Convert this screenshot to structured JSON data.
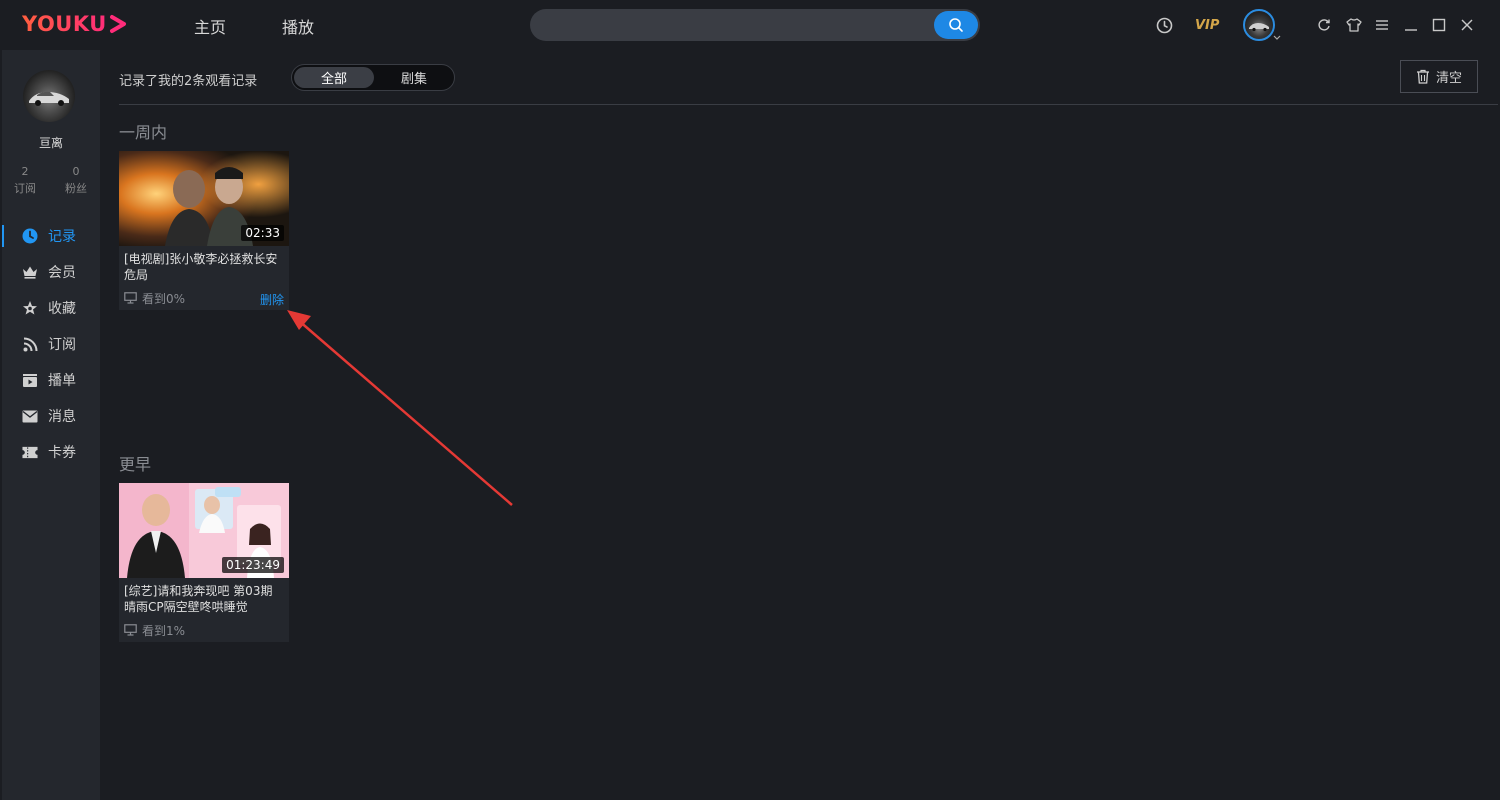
{
  "app": {
    "logo": "YOUKU",
    "nav": [
      "主页",
      "播放"
    ],
    "search_placeholder": "",
    "vip_label": "VIP"
  },
  "sidebar": {
    "user_name": "亘离",
    "stats": [
      {
        "value": "2",
        "label": "订阅"
      },
      {
        "value": "0",
        "label": "粉丝"
      }
    ],
    "items": [
      {
        "label": "记录",
        "icon": "clock-icon",
        "active": true
      },
      {
        "label": "会员",
        "icon": "crown-icon",
        "active": false
      },
      {
        "label": "收藏",
        "icon": "star-icon",
        "active": false
      },
      {
        "label": "订阅",
        "icon": "rss-icon",
        "active": false
      },
      {
        "label": "播单",
        "icon": "playlist-icon",
        "active": false
      },
      {
        "label": "消息",
        "icon": "mail-icon",
        "active": false
      },
      {
        "label": "卡券",
        "icon": "ticket-icon",
        "active": false
      }
    ]
  },
  "main": {
    "summary": "记录了我的2条观看记录",
    "filters": [
      "全部",
      "剧集"
    ],
    "clear_label": "清空",
    "sections": [
      {
        "title": "一周内",
        "items": [
          {
            "title": "[电视剧]张小敬李必拯救长安危局",
            "duration": "02:33",
            "progress": "看到0%",
            "delete_label": "删除"
          }
        ]
      },
      {
        "title": "更早",
        "items": [
          {
            "title": "[综艺]请和我奔现吧 第03期 晴雨CP隔空壁咚哄睡觉",
            "duration": "01:23:49",
            "progress": "看到1%"
          }
        ]
      }
    ]
  },
  "colors": {
    "accent": "#2196f3",
    "background": "#1b1d22",
    "sidebar": "#24272d",
    "arrow": "#e53935"
  }
}
